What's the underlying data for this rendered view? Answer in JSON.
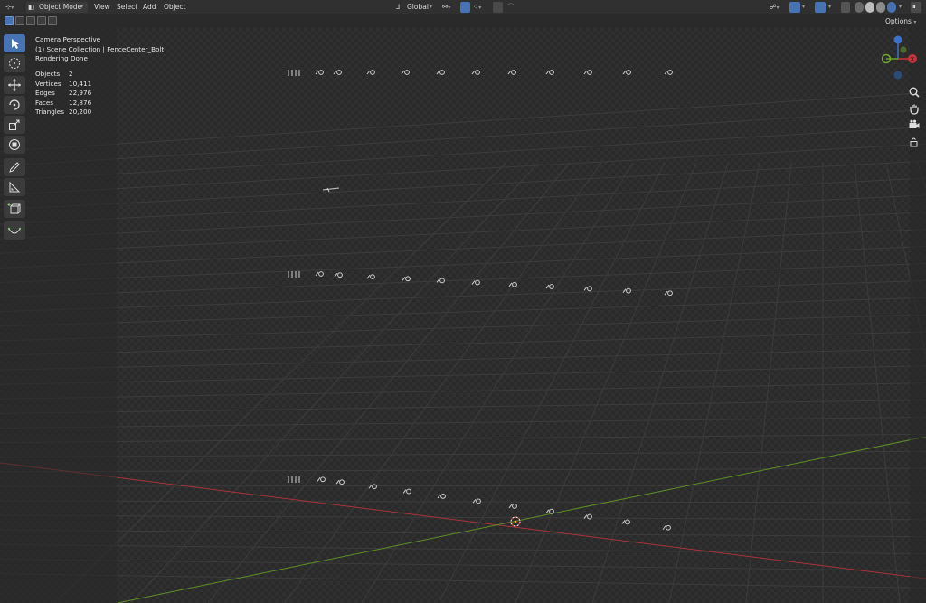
{
  "header": {
    "editor_type_icon": "editor-type-icon",
    "mode": "Object Mode",
    "menus": [
      "View",
      "Select",
      "Add",
      "Object"
    ],
    "transform_orientation": "Global"
  },
  "tool_settings": {
    "options_label": "Options"
  },
  "overlay": {
    "view_name": "Camera Perspective",
    "collection_path": "(1) Scene Collection | FenceCenter_Bolt",
    "render_status": "Rendering Done",
    "stats": [
      {
        "label": "Objects",
        "value": "2"
      },
      {
        "label": "Vertices",
        "value": "10,411"
      },
      {
        "label": "Edges",
        "value": "22,976"
      },
      {
        "label": "Faces",
        "value": "12,876"
      },
      {
        "label": "Triangles",
        "value": "20,200"
      }
    ]
  },
  "gizmo": {
    "axes": [
      "Z",
      "Y",
      "X"
    ],
    "x_label": "X"
  },
  "colors": {
    "x_axis": "#c8343b",
    "y_axis": "#6ea62c",
    "z_axis": "#3a72c8",
    "active_tool": "#4772b3",
    "header_bg": "#303030"
  },
  "toolbar_tools": [
    "select-box-tool",
    "cursor-tool",
    "move-tool",
    "rotate-tool",
    "scale-tool",
    "transform-tool",
    "annotate-tool",
    "measure-tool",
    "add-cube-tool",
    "shear-tool"
  ]
}
